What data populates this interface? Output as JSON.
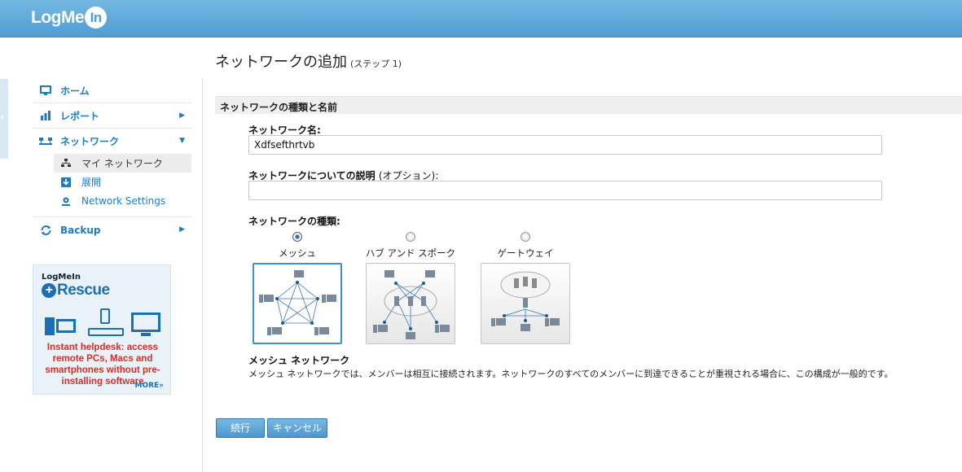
{
  "header": {
    "logo_text": "LogMe",
    "logo_in": "In"
  },
  "sidebar": {
    "collapse_glyph": "‹",
    "items": [
      {
        "label": "ホーム",
        "icon": "monitor-icon"
      },
      {
        "label": "レポート",
        "icon": "bar-chart-icon"
      },
      {
        "label": "ネットワーク",
        "icon": "network-icon"
      },
      {
        "label": "Backup",
        "icon": "sync-icon"
      }
    ],
    "network_sub": [
      {
        "label": "マイ ネットワーク",
        "icon": "hierarchy-icon"
      },
      {
        "label": "展開",
        "icon": "download-icon"
      },
      {
        "label": "Network Settings",
        "icon": "gear-icon"
      }
    ]
  },
  "ad": {
    "brand": "LogMeIn",
    "product": "Rescue",
    "tagline": "Instant helpdesk: access remote PCs, Macs  and smartphones without pre-installing software",
    "more": "MORE»"
  },
  "page": {
    "title": "ネットワークの追加",
    "step": "(ステップ 1)",
    "section": "ネットワークの種類と名前"
  },
  "form": {
    "name_label": "ネットワーク名:",
    "name_value": "Xdfsefthrtvb",
    "desc_label": "ネットワークについての説明",
    "desc_optional": "(オプション):",
    "desc_value": "",
    "type_label": "ネットワークの種類:",
    "types": [
      {
        "label": "メッシュ",
        "selected": true
      },
      {
        "label": "ハブ アンド スポーク",
        "selected": false
      },
      {
        "label": "ゲートウェイ",
        "selected": false
      }
    ],
    "selected_title": "メッシュ ネットワーク",
    "selected_desc": "メッシュ ネットワークでは、メンバーは相互に接続されます。ネットワークのすべてのメンバーに到達できることが重視される場合に、この構成が一般的です。"
  },
  "buttons": {
    "continue": "続行",
    "cancel": "キャンセル"
  },
  "colors": {
    "accent": "#1f7bc1",
    "header": "#5ea8da",
    "ad_red": "#d0312d"
  }
}
